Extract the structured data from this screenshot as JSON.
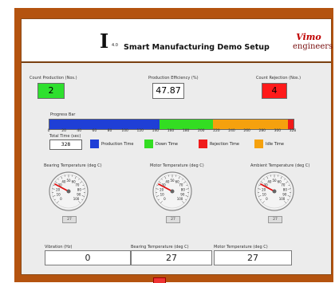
{
  "header": {
    "logo_letter": "I",
    "logo_version": "4.0",
    "title": "Smart Manufacturing Demo Setup",
    "brand_mark": "Vimo",
    "brand_word": "engineers"
  },
  "indicators": {
    "count_production": {
      "label": "Count Production (Nos.)",
      "value": "2",
      "color": "#2ee02e"
    },
    "production_efficiency": {
      "label": "Production Efficiency (%)",
      "value": "47.87"
    },
    "count_rejection": {
      "label": "Count Rejection (Nos.)",
      "value": "4",
      "color": "#ff1a1a"
    }
  },
  "progress": {
    "label": "Progress Bar",
    "max": 328,
    "segments": [
      {
        "name": "Production Time",
        "value": 148,
        "color": "#1f3fd6"
      },
      {
        "name": "Down Time",
        "value": 72,
        "color": "#33dd22"
      },
      {
        "name": "Idle Time",
        "value": 100,
        "color": "#f5a10e"
      },
      {
        "name": "Rejection Time",
        "value": 8,
        "color": "#f01a1a"
      }
    ],
    "ticks": [
      "0",
      "20",
      "40",
      "60",
      "80",
      "100",
      "120",
      "140",
      "160",
      "180",
      "200",
      "220",
      "240",
      "260",
      "280",
      "300",
      "328"
    ],
    "total_label": "Total Time (sec)",
    "total_value": "328"
  },
  "legend": [
    {
      "label": "Production Time",
      "color": "#1f3fd6"
    },
    {
      "label": "Down Time",
      "color": "#33dd22"
    },
    {
      "label": "Rejection Time",
      "color": "#f01a1a"
    },
    {
      "label": "Idle Time",
      "color": "#f5a10e"
    }
  ],
  "gauges": [
    {
      "label": "Bearing Temperature (deg C)",
      "value": 27,
      "readout": "27"
    },
    {
      "label": "Motor Temperature (deg C)",
      "value": 27,
      "readout": "27"
    },
    {
      "label": "Ambient Temperature (deg C)",
      "value": 27,
      "readout": "27"
    }
  ],
  "gauge_scale": [
    "0",
    "10",
    "20",
    "30",
    "40",
    "50",
    "60",
    "70",
    "80",
    "90",
    "100"
  ],
  "numerics": {
    "vibration": {
      "label": "Vibration (Hz)",
      "value": "0"
    },
    "bearing_temp": {
      "label": "Bearing Temperature (deg C)",
      "value": "27"
    },
    "motor_temp": {
      "label": "Motor Temperature (deg C)",
      "value": "27"
    }
  }
}
